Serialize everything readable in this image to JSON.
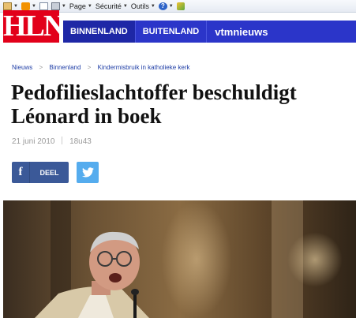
{
  "toolbar": {
    "page_label": "Page",
    "security_label": "Sécurité",
    "tools_label": "Outils",
    "icons": [
      "home-icon",
      "rss-icon",
      "mail-icon",
      "print-icon",
      "help-icon",
      "extension-icon"
    ]
  },
  "site": {
    "logo_text": "HLN",
    "brand_color": "#e2001a",
    "nav_color": "#2b35c9",
    "nav": [
      {
        "label": "BINNENLAND"
      },
      {
        "label": "BUITENLAND"
      },
      {
        "label": "vtmnieuws"
      }
    ]
  },
  "breadcrumb": [
    "Nieuws",
    "Binnenland",
    "Kindermisbruik in katholieke kerk"
  ],
  "article": {
    "title": "Pedofilieslachtoffer beschuldigt Léonard in boek",
    "date": "21 juni 2010",
    "time": "18u43"
  },
  "share": {
    "facebook_label": "DEEL",
    "facebook_color": "#3b5998",
    "twitter_color": "#55acee"
  }
}
